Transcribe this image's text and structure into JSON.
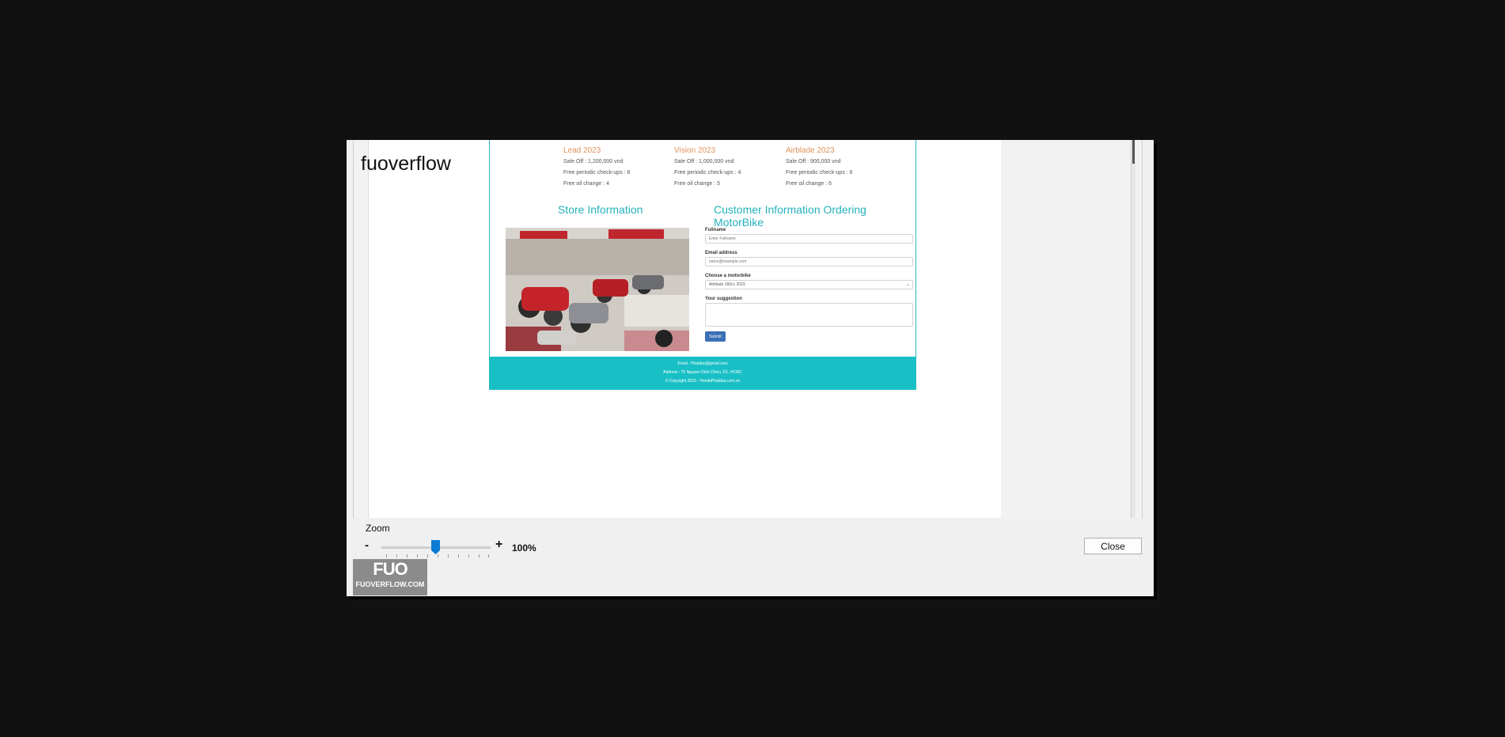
{
  "viewer": {
    "title": "fuoverflow",
    "close_label": "Close",
    "zoom": {
      "label": "Zoom",
      "minus": "-",
      "plus": "+",
      "value": "100%",
      "level_percent": 100
    }
  },
  "promotions": [
    {
      "name": "Lead 2023",
      "sale": "Sale Off : 1,200,000 vnd",
      "checkups": "Free periodic check-ups : 6",
      "oil": "Free oil change : 4"
    },
    {
      "name": "Vision 2023",
      "sale": "Sale Off : 1,000,000 vnd",
      "checkups": "Free periodic check-ups : 4",
      "oil": "Free oil change : 5"
    },
    {
      "name": "Airblade 2023",
      "sale": "Sale Off : 900,000 vnd",
      "checkups": "Free periodic check-ups : 6",
      "oil": "Free oil change : 6"
    }
  ],
  "store": {
    "heading": "Store Information"
  },
  "form": {
    "heading": "Customer Information Ordering MotorBike",
    "fullname_label": "Fullname",
    "fullname_placeholder": "Enter Fullname",
    "email_label": "Email address",
    "email_placeholder": "name@example.com",
    "motorbike_label": "Choose a motorbike",
    "motorbike_selected": "Airblade 160cc 2023",
    "suggestion_label": "Your suggestion",
    "submit_label": "Submit"
  },
  "footer": {
    "email": "Email : Phatdao@gmail.com",
    "address": "Address : 75 Nguyen Dinh Chieu, D1, HCMC",
    "copyright": "© Copyright 2023 - HondaPhatdao.com.vn"
  },
  "logo": {
    "main": "FUO",
    "sub": "FUOVERFLOW.COM"
  },
  "colors": {
    "accent_teal": "#25b2bd",
    "footer_teal": "#18c0c6",
    "promo_orange": "#e0925a",
    "submit_blue": "#3b6fb6",
    "slider_blue": "#0a7bd4"
  }
}
